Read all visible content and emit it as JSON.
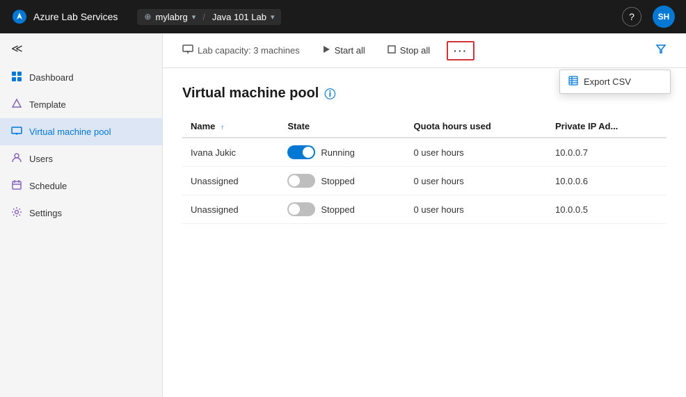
{
  "topNav": {
    "title_azure": "Azure",
    "title_lab": "Lab Services",
    "breadcrumb_org": "mylabrg",
    "breadcrumb_sep": "/",
    "breadcrumb_lab": "Java 101 Lab",
    "help_label": "?",
    "user_initials": "SH"
  },
  "sidebar": {
    "collapse_icon": "«",
    "items": [
      {
        "id": "dashboard",
        "label": "Dashboard",
        "icon": "⊞",
        "active": false
      },
      {
        "id": "template",
        "label": "Template",
        "icon": "△",
        "active": false
      },
      {
        "id": "vmpool",
        "label": "Virtual machine pool",
        "icon": "▭",
        "active": true
      },
      {
        "id": "users",
        "label": "Users",
        "icon": "♡",
        "active": false
      },
      {
        "id": "schedule",
        "label": "Schedule",
        "icon": "☷",
        "active": false
      },
      {
        "id": "settings",
        "label": "Settings",
        "icon": "⚙",
        "active": false
      }
    ]
  },
  "toolbar": {
    "capacity_icon": "monitor",
    "capacity_label": "Lab capacity: 3 machines",
    "start_all_label": "Start all",
    "stop_all_label": "Stop all",
    "more_label": "···",
    "filter_icon": "▽"
  },
  "dropdown": {
    "items": [
      {
        "id": "export-csv",
        "icon": "▦",
        "label": "Export CSV"
      }
    ]
  },
  "pageContent": {
    "title": "Virtual machine pool",
    "info_icon": "ⓘ",
    "table": {
      "columns": [
        {
          "id": "name",
          "label": "Name",
          "sortable": true
        },
        {
          "id": "state",
          "label": "State"
        },
        {
          "id": "quota",
          "label": "Quota hours used"
        },
        {
          "id": "ip",
          "label": "Private IP Ad..."
        }
      ],
      "rows": [
        {
          "name": "Ivana Jukic",
          "state": "Running",
          "toggle": "on",
          "quota": "0 user hours",
          "ip": "10.0.0.7"
        },
        {
          "name": "Unassigned",
          "state": "Stopped",
          "toggle": "off",
          "quota": "0 user hours",
          "ip": "10.0.0.6"
        },
        {
          "name": "Unassigned",
          "state": "Stopped",
          "toggle": "off",
          "quota": "0 user hours",
          "ip": "10.0.0.5"
        }
      ]
    }
  }
}
